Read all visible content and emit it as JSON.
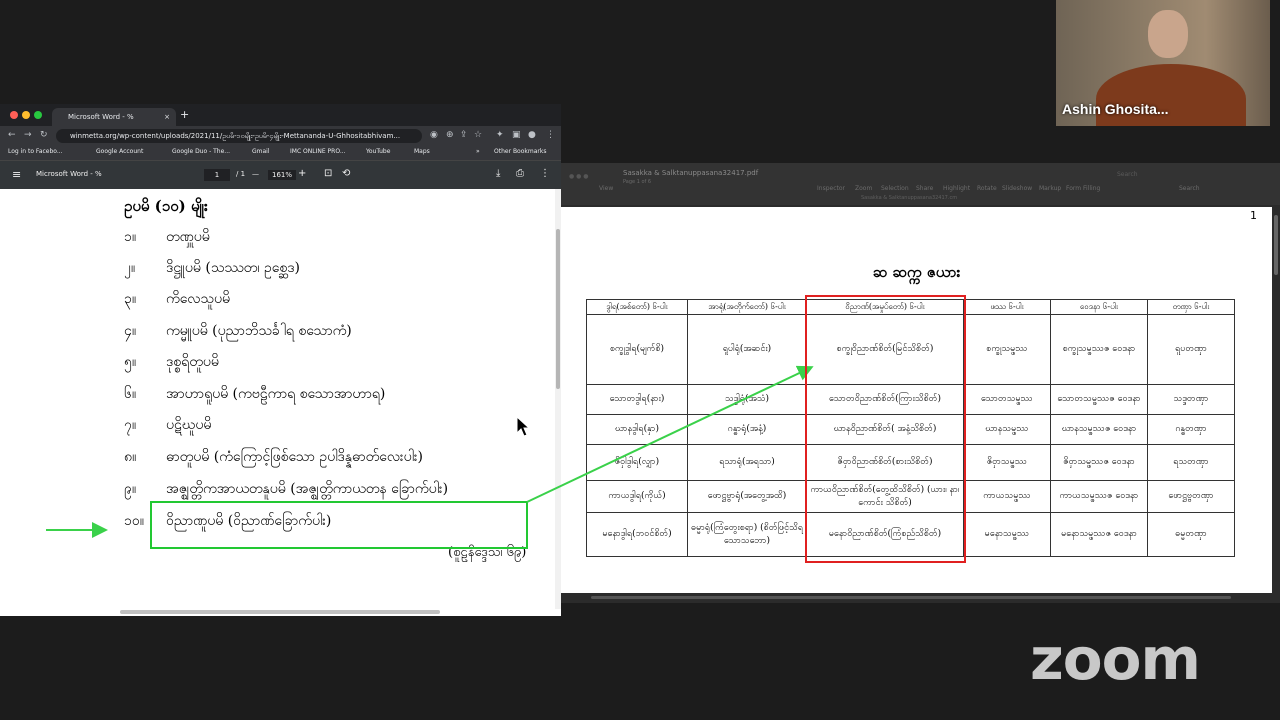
{
  "video": {
    "participant_name": "Ashin Ghosita..."
  },
  "chrome": {
    "tab_title": "Microsoft Word - %",
    "tab_close": "×",
    "new_tab": "+",
    "address": "winmetta.org/wp-content/uploads/2021/11/ဥပမိ-၁၀မျိုး-ဥပမိ-၄မျိုး-Mettananda-U-Ghhositabhivam...",
    "bookmarks": [
      "Log in to Facebo...",
      "Google Account",
      "Google Duo - The...",
      "Gmail",
      "IMC ONLINE PRO...",
      "YouTube",
      "Maps",
      "»",
      "Other Bookmarks"
    ],
    "pdf_title": "Microsoft Word - %",
    "page_current": "1",
    "page_total": "/ 1",
    "zoom": "161%",
    "minus": "—",
    "plus": "+"
  },
  "document": {
    "heading": "ဥပမိ (၁၀) မျိုး",
    "items": [
      {
        "num": "၁။",
        "text": "တဏှူပမိ"
      },
      {
        "num": "၂။",
        "text": "ဒိဋ္ဌူပမိ (သဿတ၊ ဥစ္ဆေဒ)"
      },
      {
        "num": "၃။",
        "text": "ကိလေသူပမိ"
      },
      {
        "num": "၄။",
        "text": "ကမ္မူပမိ (ပုညာဘိသင်္ခါရ စသောကံ)"
      },
      {
        "num": "၅။",
        "text": "ဒုစ္စရိတူပမိ"
      },
      {
        "num": "၆။",
        "text": "အာဟာရူပမိ (ကဗဠီကာရ စသောအာဟာရ)"
      },
      {
        "num": "၇။",
        "text": "ပဋိဃူပမိ"
      },
      {
        "num": "၈။",
        "text": "ဓာတူပမိ (ကံကြောင့်ဖြစ်သော ဥပါဒိန္နဓာတ်လေးပါး)"
      },
      {
        "num": "၉။",
        "text": "အဇ္ဈတ္တိကအာယတနူပမိ (အဇ္ဈတ္တိကာယတန ခြောက်ပါး)"
      },
      {
        "num": "၁၀။",
        "text": "ဝိညာဏူပမိ (ဝိညာဏ်ခြောက်ပါး)"
      }
    ],
    "citation": "(စူဠနိဒ္ဒေသ၊ ၆၉)"
  },
  "preview": {
    "window_title": "Sasakka & Salktanuppasana32417.pdf",
    "window_subtitle": "Page 1 of 6",
    "path": "Sasakka & Salktanuppasana32417.cm",
    "toolbar": [
      "View",
      "Inspector",
      "Zoom",
      "Selection",
      "Share",
      "Highlight",
      "Rotate",
      "Slideshow",
      "Markup",
      "Form Filling",
      "Search"
    ],
    "search_placeholder": "Search",
    "page_number": "1",
    "title": "ဆ ဆက္က ဇယား",
    "headers": [
      "ဒွါရ(အစ်တော်) ၆-ပါး",
      "အာရုံ(အတိုက်တော်) ၆-ပါး",
      "ဝိညာဏ်(အမှုပ်တော်) ၆-ပါး",
      "ဖဿ ၆-ပါး",
      "ဝေဒနာ ၆-ပါး",
      "တဏှာ ၆-ပါး"
    ],
    "rows": [
      [
        "စက္ခုဒွါရ(မျက်စိ)",
        "ရူပါရုံ(အဆင်း)",
        "စက္ခုဝိညာဏ်စိတ်(မြင်သိစိတ်)",
        "စက္ခုသမ္ဖဿ",
        "စက္ခုသမ္ဖဿဇ ဝေဒနာ",
        "ရူပတဏှာ"
      ],
      [
        "သောတဒွါရ(နား)",
        "သဒ္ဒါရုံ(အသံ)",
        "သောတဝိညာဏ်စိတ်(ကြားသိစိတ်)",
        "သောတသမ္ဖဿ",
        "သောတသမ္ဖဿဇ ဝေဒနာ",
        "သဒ္ဒတဏှာ"
      ],
      [
        "ဃာနဒွါရ(နှာ)",
        "ဂန္ဓာရုံ(အနံ့)",
        "ဃာနဝိညာဏ်စိတ်( အနံ့သိစိတ်)",
        "ဃာနသမ္ဖဿ",
        "ဃာနသမ္ဖဿဇ ဝေဒနာ",
        "ဂန္ဓတဏှာ"
      ],
      [
        "ဇိဝှါဒွါရ(လျှာ)",
        "ရသာရုံ(အရသာ)",
        "ဇိဝှာဝိညာဏ်စိတ်(စားသိစိတ်)",
        "ဇိဝှာသမ္ဖဿ",
        "ဇိဝှာသမ္ဖဿဇ ဝေဒနာ",
        "ရသတဏှာ"
      ],
      [
        "ကာယဒွါရ(ကိုယ်)",
        "ဖောဋ္ဌဗ္ဗာရုံ(အတွေ့အထိ)",
        "ကာယဝိညာဏ်စိတ်(တွေ့ထိသိစိတ်) (ယား၊ နာ၊ ကောင်း သိစိတ်)",
        "ကာယသမ္ဖဿ",
        "ကာယသမ္ဖဿဇ ဝေဒနာ",
        "ဖောဋ္ဌဗ္ဗတဏှာ"
      ],
      [
        "မနောဒွါရ(ဘဝင်စိတ်)",
        "ဓမ္မာရုံ(ကြံတွေးစရာ) (စိတ်ဖြင့်သိရသောသဘော)",
        "မနောဝိညာဏ်စိတ်(ကြံစည်သိစိတ်)",
        "မနောသမ္ဖဿ",
        "မနောသမ္ဖဿဇ ဝေဒနာ",
        "ဓမ္မတဏှာ"
      ]
    ]
  },
  "zoom_logo": "zoom",
  "colors": {
    "highlight_green": "#22c832",
    "highlight_red": "#e02020",
    "arrow_green": "#3ad14a"
  }
}
